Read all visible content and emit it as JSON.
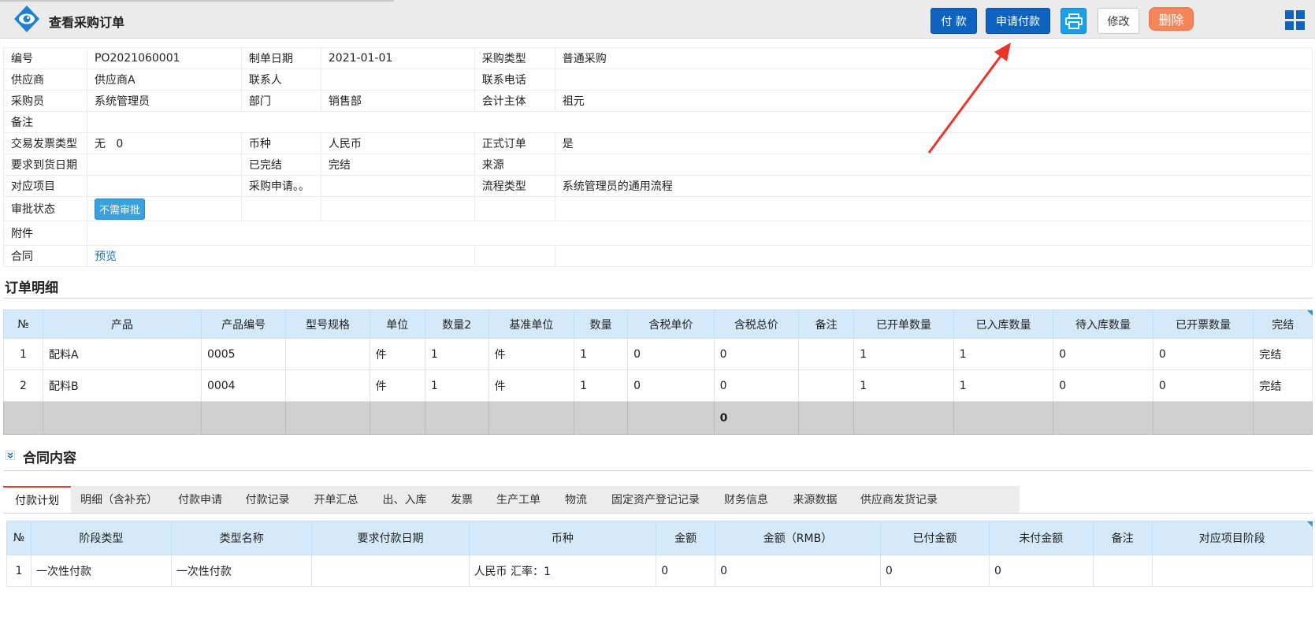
{
  "header": {
    "title": "查看采购订单",
    "buttons": {
      "pay": "付 款",
      "apply_pay": "申请付款",
      "edit": "修改",
      "delete": "删除"
    }
  },
  "info": {
    "row1": [
      "编号",
      "PO2021060001",
      "制单日期",
      "2021-01-01",
      "采购类型",
      "普通采购"
    ],
    "row2": [
      "供应商",
      "供应商A",
      "联系人",
      "",
      "联系电话",
      ""
    ],
    "row3": [
      "采购员",
      "系统管理员",
      "部门",
      "销售部",
      "会计主体",
      "祖元"
    ],
    "row4": [
      "备注",
      ""
    ],
    "row5": [
      "交易发票类型",
      "无   0",
      "币种",
      "人民币",
      "正式订单",
      "是"
    ],
    "row6": [
      "要求到货日期",
      "",
      "已完结",
      "完结",
      "来源",
      ""
    ],
    "row7": [
      "对应项目",
      "",
      "采购申请。。",
      "",
      "流程类型",
      "系统管理员的通用流程"
    ],
    "approval_label": "审批状态",
    "approval_badge": "不需审批",
    "attachment_label": "附件",
    "contract_label": "合同",
    "contract_link": "预览"
  },
  "detail": {
    "title": "订单明细",
    "headers": [
      "№",
      "产品",
      "产品编号",
      "型号规格",
      "单位",
      "数量2",
      "基准单位",
      "数量",
      "含税单价",
      "含税总价",
      "备注",
      "已开单数量",
      "已入库数量",
      "待入库数量",
      "已开票数量",
      "完结"
    ],
    "rows": [
      [
        "1",
        "配料A",
        "0005",
        "",
        "件",
        "1",
        "件",
        "1",
        "0",
        "0",
        "",
        "1",
        "1",
        "0",
        "0",
        "完结"
      ],
      [
        "2",
        "配料B",
        "0004",
        "",
        "件",
        "1",
        "件",
        "1",
        "0",
        "0",
        "",
        "1",
        "1",
        "0",
        "0",
        "完结"
      ]
    ],
    "sum_total": "0"
  },
  "contract": {
    "title": "合同内容",
    "tabs": [
      "付款计划",
      "明细（含补充）",
      "付款申请",
      "付款记录",
      "开单汇总",
      "出、入库",
      "发票",
      "生产工单",
      "物流",
      "固定资产登记记录",
      "财务信息",
      "来源数据",
      "供应商发货记录"
    ]
  },
  "payment": {
    "headers": [
      "№",
      "阶段类型",
      "类型名称",
      "要求付款日期",
      "币种",
      "金额",
      "金额（RMB）",
      "已付金额",
      "未付金额",
      "备注",
      "对应项目阶段"
    ],
    "rows": [
      [
        "1",
        "一次性付款",
        "一次性付款",
        "",
        "人民币 汇率：1",
        "0",
        "0",
        "0",
        "0",
        "",
        ""
      ]
    ]
  },
  "colors": {
    "primary": "#0e63c0",
    "print": "#1aa0e6",
    "danger": "#f7855a",
    "header_bg": "#ebebeb",
    "table_head": "#d4eafa",
    "arrow": "#e8362a"
  }
}
